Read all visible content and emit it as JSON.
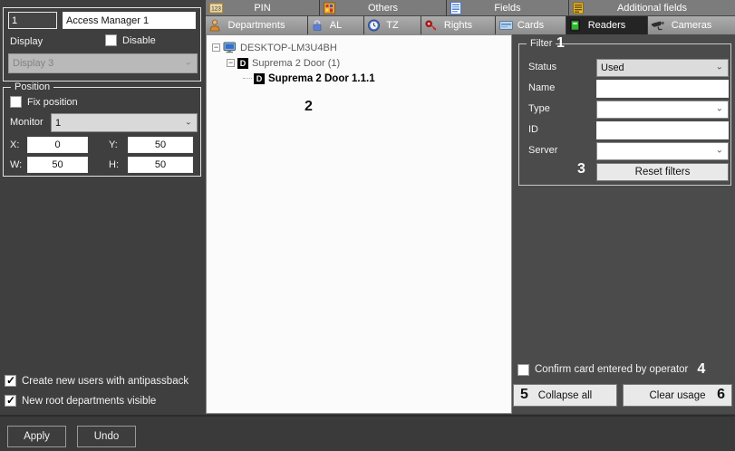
{
  "left_panel": {
    "id_value": "1",
    "name_value": "Access Manager 1",
    "display_label": "Display",
    "disable_label": "Disable",
    "display_select_value": "Display 3",
    "position": {
      "title": "Position",
      "fix_position_label": "Fix position",
      "monitor_label": "Monitor",
      "monitor_value": "1",
      "x_label": "X:",
      "x_value": "0",
      "y_label": "Y:",
      "y_value": "50",
      "w_label": "W:",
      "w_value": "50",
      "h_label": "H:",
      "h_value": "50"
    },
    "checkboxes": [
      {
        "label": "Create new users with antipassback",
        "checked": true
      },
      {
        "label": "New root departments visible",
        "checked": true
      }
    ]
  },
  "tabs": {
    "row1": [
      {
        "label": "PIN",
        "icon": "pin-123-icon"
      },
      {
        "label": "Others",
        "icon": "others-icon"
      },
      {
        "label": "Fields",
        "icon": "fields-icon"
      },
      {
        "label": "Additional fields",
        "icon": "additional-fields-icon"
      }
    ],
    "row2": [
      {
        "label": "Departments",
        "icon": "person-icon",
        "selected": false
      },
      {
        "label": "AL",
        "icon": "lock-icon",
        "selected": false
      },
      {
        "label": "TZ",
        "icon": "clock-icon",
        "selected": false
      },
      {
        "label": "Rights",
        "icon": "key-icon",
        "selected": false
      },
      {
        "label": "Cards",
        "icon": "card-icon",
        "selected": false
      },
      {
        "label": "Readers",
        "icon": "reader-icon",
        "selected": true
      },
      {
        "label": "Cameras",
        "icon": "camera-icon",
        "selected": false
      }
    ]
  },
  "tree": {
    "expander_glyph": "−",
    "nodes": [
      {
        "label": "DESKTOP-LM3U4BH",
        "icon": "computer-icon",
        "level": 0
      },
      {
        "label": "Suprema 2 Door (1)",
        "icon": "door-d-icon",
        "icon_text": "D",
        "level": 1
      },
      {
        "label": "Suprema 2 Door 1.1.1",
        "icon": "door-d-icon",
        "icon_text": "D",
        "level": 2,
        "bold": true
      }
    ]
  },
  "filter": {
    "title": "Filter",
    "rows": [
      {
        "label": "Status",
        "type": "select",
        "value": "Used"
      },
      {
        "label": "Name",
        "type": "input",
        "value": ""
      },
      {
        "label": "Type",
        "type": "select",
        "value": ""
      },
      {
        "label": "ID",
        "type": "input",
        "value": ""
      },
      {
        "label": "Server",
        "type": "select",
        "value": ""
      }
    ],
    "reset_button": "Reset filters"
  },
  "right_bottom": {
    "confirm_label": "Confirm card entered by operator",
    "collapse_all_button": "Collapse all",
    "clear_usage_button": "Clear usage"
  },
  "bottom_bar": {
    "apply_button": "Apply",
    "undo_button": "Undo"
  },
  "annotations": {
    "n1": "1",
    "n2": "2",
    "n3": "3",
    "n4": "4",
    "n5": "5",
    "n6": "6"
  },
  "colors": {
    "panel_dark": "#3f3f3f",
    "panel_right": "#4b4b4b",
    "tab_selected": "#242424",
    "tree_bg": "#fbfbfb",
    "accent_green": "#2db82d"
  }
}
